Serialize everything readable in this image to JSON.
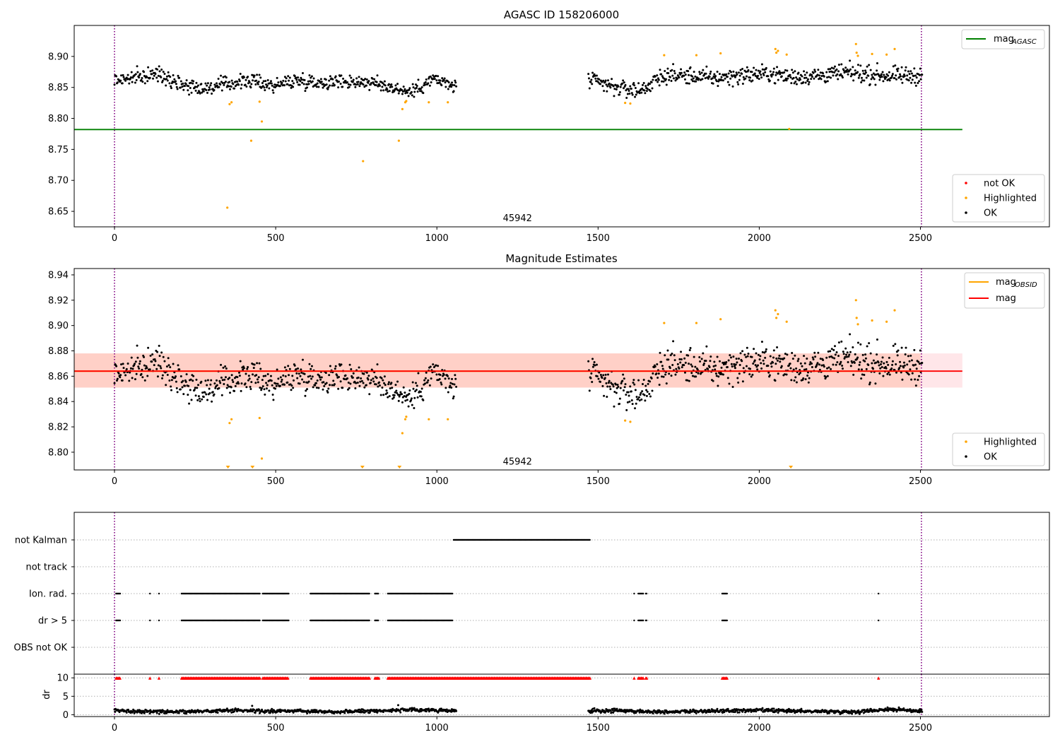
{
  "chart_data": [
    {
      "type": "scatter",
      "title": "AGASC ID 158206000",
      "xlim": [
        -125,
        2900
      ],
      "ylim": [
        8.625,
        8.95
      ],
      "xticks": [
        0,
        500,
        1000,
        1500,
        2000,
        2500
      ],
      "yticks": [
        8.65,
        8.7,
        8.75,
        8.8,
        8.85,
        8.9
      ],
      "vlines": [
        0,
        2503
      ],
      "annotation": {
        "text": "45942",
        "x": 1250,
        "y": 8.64
      },
      "hline": {
        "name": "mag_AGASC",
        "y": 8.782,
        "x": [
          -125,
          2630
        ],
        "color": "#008000"
      },
      "legend_lines": [
        {
          "label": "mag",
          "sub": "AGASC",
          "color": "#008000"
        }
      ],
      "legend_points": [
        {
          "label": "not OK",
          "color": "#ff0000"
        },
        {
          "label": "Highlighted",
          "color": "#ffa500"
        },
        {
          "label": "OK",
          "color": "#000000"
        }
      ],
      "series": [
        {
          "name": "OK",
          "color": "#000000",
          "segments": [
            {
              "x": [
                0,
                1060
              ],
              "center": [
                8.862,
                8.866,
                8.872,
                8.855,
                8.848,
                8.856,
                8.861,
                8.853,
                8.862,
                8.858,
                8.86,
                8.859,
                8.852,
                8.842,
                8.864,
                8.85
              ],
              "spread": 0.012
            },
            {
              "x": [
                1470,
                2505
              ],
              "center": [
                8.862,
                8.85,
                8.845,
                8.87,
                8.868,
                8.865,
                8.87,
                8.872,
                8.867,
                8.869,
                8.874,
                8.871,
                8.868,
                8.87
              ],
              "spread": 0.014
            }
          ]
        },
        {
          "name": "Highlighted",
          "color": "#ffa500",
          "x": [
            350,
            357,
            363,
            424,
            450,
            457,
            771,
            882,
            893,
            902,
            905,
            975,
            1034,
            1584,
            1600,
            1705,
            1805,
            1880,
            2050,
            2053,
            2058,
            2085,
            2093,
            2300,
            2302,
            2306,
            2350,
            2395,
            2420
          ],
          "y": [
            8.656,
            8.823,
            8.826,
            8.764,
            8.827,
            8.795,
            8.731,
            8.764,
            8.815,
            8.826,
            8.828,
            8.826,
            8.826,
            8.825,
            8.824,
            8.902,
            8.902,
            8.905,
            8.912,
            8.906,
            8.909,
            8.903,
            8.783,
            8.92,
            8.906,
            8.901,
            8.904,
            8.903,
            8.912
          ]
        }
      ]
    },
    {
      "type": "scatter",
      "title": "Magnitude Estimates",
      "xlim": [
        -125,
        2900
      ],
      "ylim": [
        8.786,
        8.945
      ],
      "xticks": [
        0,
        500,
        1000,
        1500,
        2000,
        2500
      ],
      "yticks": [
        8.8,
        8.82,
        8.84,
        8.86,
        8.88,
        8.9,
        8.92,
        8.94
      ],
      "vlines": [
        0,
        2503
      ],
      "annotation": {
        "text": "45942",
        "x": 1250,
        "y": 8.793
      },
      "band": {
        "x": [
          -125,
          2630
        ],
        "y": [
          8.851,
          8.878
        ],
        "color": "#ffb6c1"
      },
      "band_inner": {
        "x": [
          -125,
          2500
        ],
        "y": [
          8.851,
          8.878
        ],
        "color": "#ffa07a"
      },
      "hline": {
        "name": "mag",
        "y": 8.864,
        "x": [
          -125,
          2630
        ],
        "color": "#ff0000"
      },
      "obsid_line": {
        "name": "mag_OBSID",
        "y": 8.864,
        "x": [
          -125,
          2500
        ],
        "color": "#ffa500"
      },
      "legend_lines": [
        {
          "label": "mag",
          "sub": "OBSID",
          "color": "#ffa500"
        },
        {
          "label": "mag",
          "sub": "",
          "color": "#ff0000"
        }
      ],
      "legend_points": [
        {
          "label": "Highlighted",
          "color": "#ffa500"
        },
        {
          "label": "OK",
          "color": "#000000"
        }
      ],
      "out_of_range_markers": [
        352,
        428,
        769,
        884,
        2098
      ],
      "series": [
        {
          "name": "OK",
          "color": "#000000",
          "segments": [
            {
              "x": [
                0,
                1060
              ],
              "center": [
                8.862,
                8.866,
                8.872,
                8.855,
                8.848,
                8.856,
                8.861,
                8.853,
                8.862,
                8.858,
                8.86,
                8.859,
                8.852,
                8.842,
                8.864,
                8.85
              ],
              "spread": 0.012
            },
            {
              "x": [
                1470,
                2505
              ],
              "center": [
                8.862,
                8.85,
                8.845,
                8.87,
                8.868,
                8.865,
                8.87,
                8.872,
                8.867,
                8.869,
                8.874,
                8.871,
                8.868,
                8.87
              ],
              "spread": 0.014
            }
          ]
        },
        {
          "name": "Highlighted",
          "color": "#ffa500",
          "x": [
            357,
            363,
            450,
            457,
            893,
            902,
            905,
            975,
            1034,
            1584,
            1600,
            1705,
            1805,
            1880,
            2050,
            2053,
            2058,
            2085,
            2300,
            2302,
            2306,
            2350,
            2395,
            2420
          ],
          "y": [
            8.823,
            8.826,
            8.827,
            8.795,
            8.815,
            8.826,
            8.828,
            8.826,
            8.826,
            8.825,
            8.824,
            8.902,
            8.902,
            8.905,
            8.912,
            8.906,
            8.909,
            8.903,
            8.92,
            8.906,
            8.901,
            8.904,
            8.903,
            8.912
          ]
        }
      ]
    },
    {
      "type": "scatter",
      "xlim": [
        -125,
        2900
      ],
      "xticks": [
        0,
        500,
        1000,
        1500,
        2000,
        2500
      ],
      "vlines": [
        0,
        2503
      ],
      "categories": [
        "not Kalman",
        "not track",
        "Ion. rad.",
        "dr > 5",
        "OBS not OK"
      ],
      "flags": [
        {
          "name": "not Kalman",
          "ranges": [
            [
              1052,
              1475
            ]
          ]
        },
        {
          "name": "not track",
          "ranges": []
        },
        {
          "name": "Ion. rad.",
          "ranges": [
            [
              5,
              18
            ],
            [
              110,
              112
            ],
            [
              138,
              140
            ],
            [
              208,
              452
            ],
            [
              460,
              540
            ],
            [
              608,
              792
            ],
            [
              808,
              820
            ],
            [
              848,
              1050
            ],
            [
              1612,
              1614
            ],
            [
              1625,
              1640
            ],
            [
              1648,
              1652
            ],
            [
              1885,
              1902
            ],
            [
              2370,
              2372
            ]
          ]
        },
        {
          "name": "dr > 5",
          "ranges": [
            [
              5,
              18
            ],
            [
              110,
              112
            ],
            [
              138,
              140
            ],
            [
              208,
              452
            ],
            [
              460,
              540
            ],
            [
              608,
              792
            ],
            [
              808,
              820
            ],
            [
              848,
              1050
            ],
            [
              1612,
              1614
            ],
            [
              1625,
              1640
            ],
            [
              1648,
              1652
            ],
            [
              1885,
              1902
            ],
            [
              2370,
              2372
            ]
          ]
        },
        {
          "name": "OBS not OK",
          "ranges": []
        }
      ]
    },
    {
      "type": "scatter",
      "xlim": [
        -125,
        2900
      ],
      "ylim": [
        -0.5,
        11
      ],
      "ylabel": "dr",
      "xticks": [
        0,
        500,
        1000,
        1500,
        2000,
        2500
      ],
      "yticks": [
        0,
        5,
        10
      ],
      "vlines": [
        0,
        2503
      ],
      "clipped_value": 10,
      "clipped_ranges": [
        [
          5,
          18
        ],
        [
          110,
          112
        ],
        [
          138,
          140
        ],
        [
          208,
          452
        ],
        [
          460,
          540
        ],
        [
          608,
          792
        ],
        [
          808,
          820
        ],
        [
          848,
          1475
        ],
        [
          1612,
          1614
        ],
        [
          1625,
          1640
        ],
        [
          1648,
          1652
        ],
        [
          1885,
          1902
        ],
        [
          2370,
          2372
        ]
      ],
      "series": [
        {
          "name": "dr",
          "color": "#000000",
          "segments": [
            {
              "x": [
                0,
                1060
              ],
              "center": [
                1.1,
                0.9,
                0.8,
                1.0,
                1.2,
                0.9,
                1.1,
                0.8,
                1.0,
                1.2,
                1.3,
                1.0
              ],
              "spread": 0.5
            },
            {
              "x": [
                1470,
                2505
              ],
              "center": [
                1.0,
                1.1,
                0.8,
                0.9,
                1.0,
                1.2,
                1.0,
                0.9,
                0.8,
                1.5,
                1.0
              ],
              "spread": 0.5
            }
          ]
        }
      ],
      "outliers": {
        "x": [
          427,
          880
        ],
        "y": [
          2.4,
          2.6
        ]
      }
    }
  ]
}
